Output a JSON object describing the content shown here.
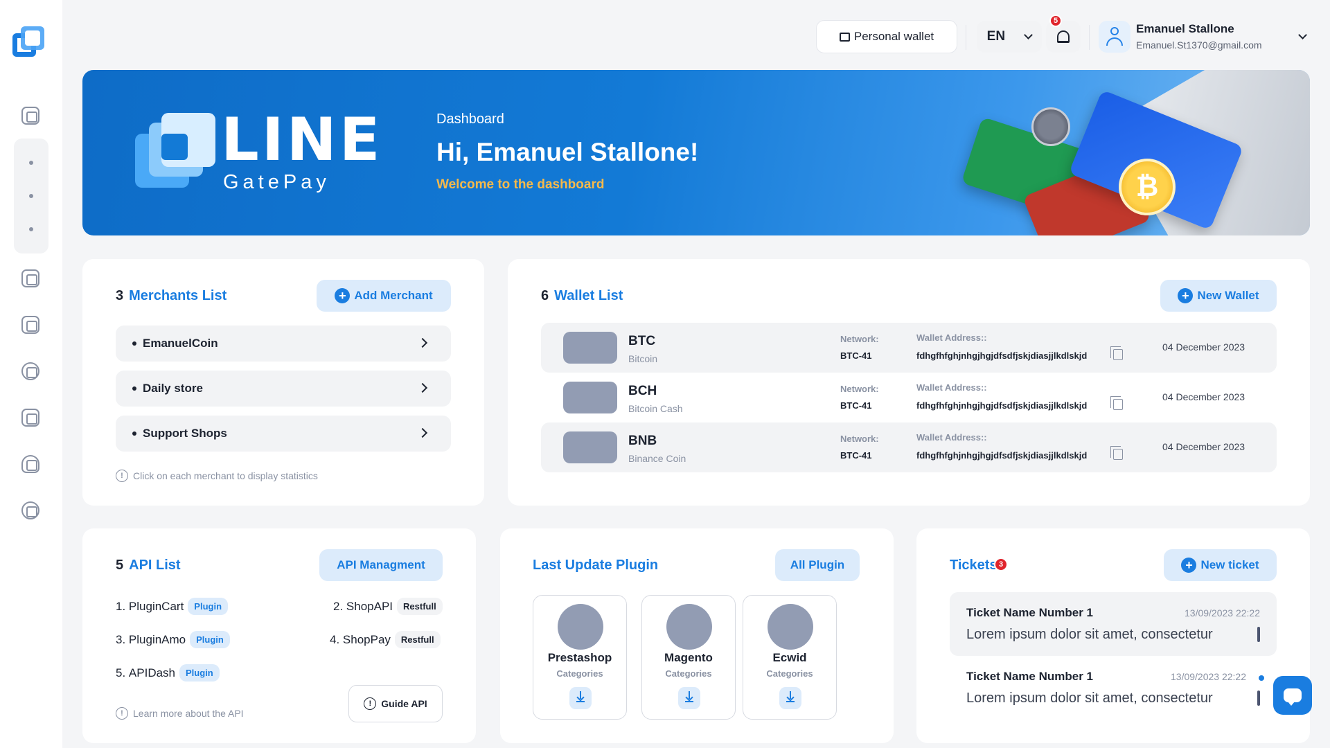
{
  "topbar": {
    "personal_wallet": "Personal wallet",
    "language": "EN",
    "notifications_count": "5",
    "user_name": "Emanuel Stallone",
    "user_email": "Emanuel.St1370@gmail.com"
  },
  "banner": {
    "brand": "LINE",
    "brand_sub": "GatePay",
    "kicker": "Dashboard",
    "title": "Hi, Emanuel Stallone!",
    "subtitle": "Welcome to the dashboard"
  },
  "merchants": {
    "count": "3",
    "title": "Merchants List",
    "add_label": "Add Merchant",
    "items": [
      "EmanuelCoin",
      "Daily store",
      "Support Shops"
    ],
    "hint": "Click on each merchant to display statistics"
  },
  "wallets": {
    "count": "6",
    "title": "Wallet List",
    "new_label": "New Wallet",
    "network_label": "Network:",
    "address_label": "Wallet Address::",
    "items": [
      {
        "symbol": "BTC",
        "name": "Bitcoin",
        "network": "BTC-41",
        "address": "fdhgfhfghjnhgjhgjdfsdfjskjdiasjjlkdlskjd",
        "date": "04 December 2023"
      },
      {
        "symbol": "BCH",
        "name": "Bitcoin Cash",
        "network": "BTC-41",
        "address": "fdhgfhfghjnhgjhgjdfsdfjskjdiasjjlkdlskjd",
        "date": "04 December 2023"
      },
      {
        "symbol": "BNB",
        "name": "Binance Coin",
        "network": "BTC-41",
        "address": "fdhgfhfghjnhgjhgjdfsdfjskjdiasjjlkdlskjd",
        "date": "04 December 2023"
      }
    ]
  },
  "api": {
    "count": "5",
    "title": "API List",
    "manage_label": "API Managment",
    "items": [
      {
        "num": "1.",
        "name": "PluginCart",
        "tag": "Plugin"
      },
      {
        "num": "2.",
        "name": "ShopAPI",
        "tag": "Restfull"
      },
      {
        "num": "3.",
        "name": "PluginAmo",
        "tag": "Plugin"
      },
      {
        "num": "4.",
        "name": "ShopPay",
        "tag": "Restfull"
      },
      {
        "num": "5.",
        "name": "APIDash",
        "tag": "Plugin"
      }
    ],
    "hint": "Learn more about the API",
    "guide_label": "Guide API"
  },
  "plugins": {
    "title": "Last Update Plugin",
    "all_label": "All Plugin",
    "items": [
      {
        "name": "Prestashop",
        "category": "Categories"
      },
      {
        "name": "Magento",
        "category": "Categories"
      },
      {
        "name": "Ecwid",
        "category": "Categories"
      }
    ]
  },
  "tickets": {
    "title": "Tickets",
    "count": "3",
    "new_label": "New ticket",
    "items": [
      {
        "name": "Ticket Name Number 1",
        "time": "13/09/2023 22:22",
        "body": "Lorem ipsum dolor sit amet, consectetur"
      },
      {
        "name": "Ticket Name Number 1",
        "time": "13/09/2023 22:22",
        "body": "Lorem ipsum dolor sit amet, consectetur"
      }
    ]
  },
  "colors": {
    "accent": "#1a7de0",
    "badge": "#e0242c",
    "banner_highlight": "#f5b94b"
  }
}
